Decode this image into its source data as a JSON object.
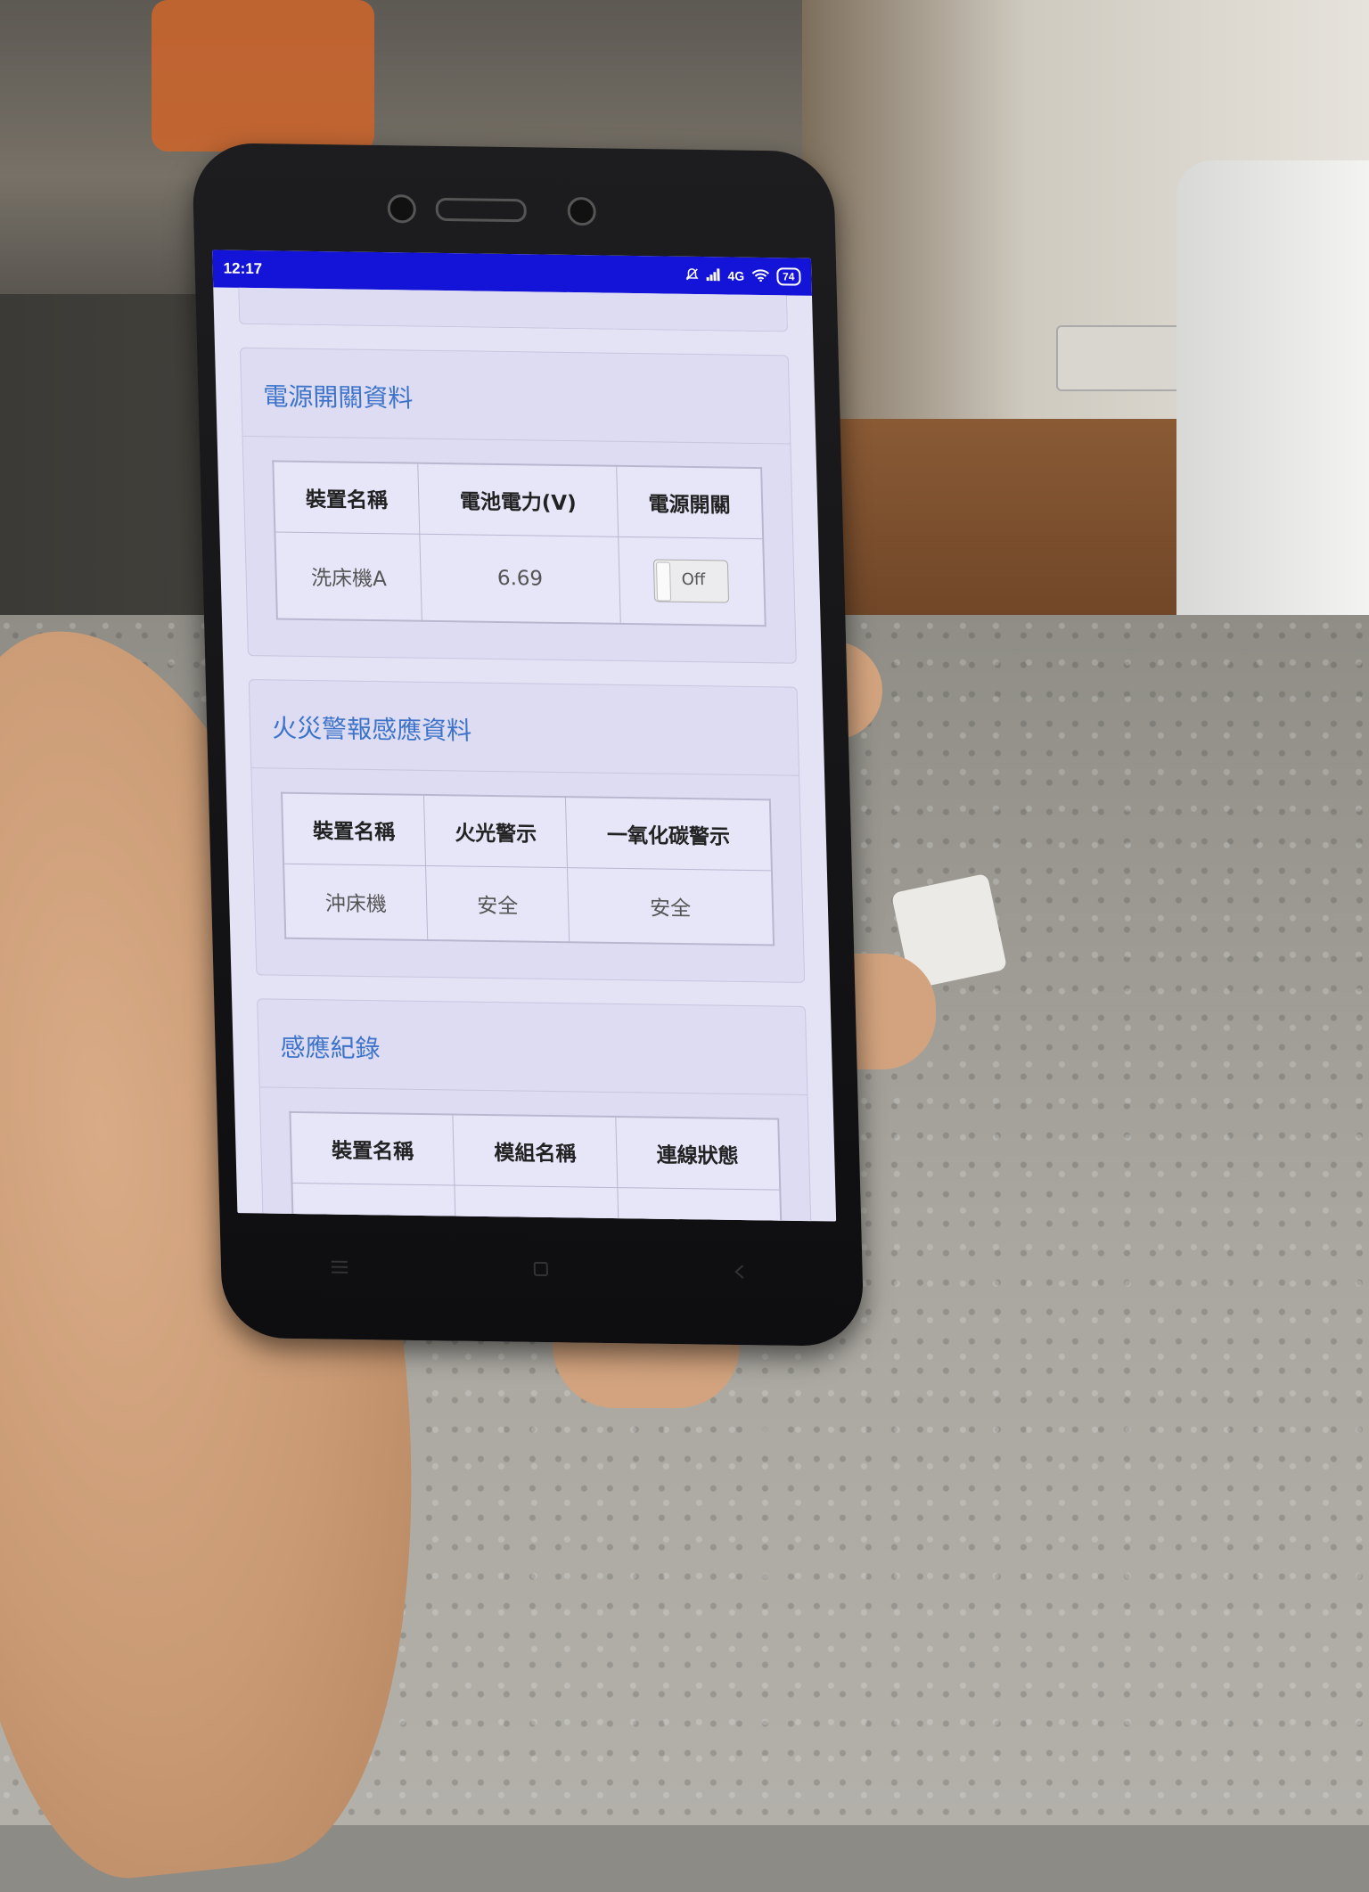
{
  "status_bar": {
    "time": "12:17",
    "network": "4G",
    "battery": "74"
  },
  "power_card": {
    "title": "電源開關資料",
    "headers": [
      "裝置名稱",
      "電池電力(V)",
      "電源開關"
    ],
    "row": {
      "device": "洗床機A",
      "voltage": "6.69",
      "switch_label": "Off"
    }
  },
  "fire_card": {
    "title": "火災警報感應資料",
    "headers": [
      "裝置名稱",
      "火光警示",
      "一氧化碳警示"
    ],
    "row": {
      "device": "沖床機",
      "flame": "安全",
      "co": "安全"
    }
  },
  "log_card": {
    "title": "感應紀錄",
    "headers": [
      "裝置名稱",
      "模組名稱",
      "連線狀態"
    ]
  },
  "colors": {
    "status_bar": "#1414d8",
    "card_title": "#3d74c9",
    "screen_bg": "#e4e2f5"
  },
  "icons": [
    "muted-bell-icon",
    "signal-icon",
    "wifi-icon",
    "battery-icon",
    "menu-icon",
    "home-icon",
    "back-icon"
  ]
}
